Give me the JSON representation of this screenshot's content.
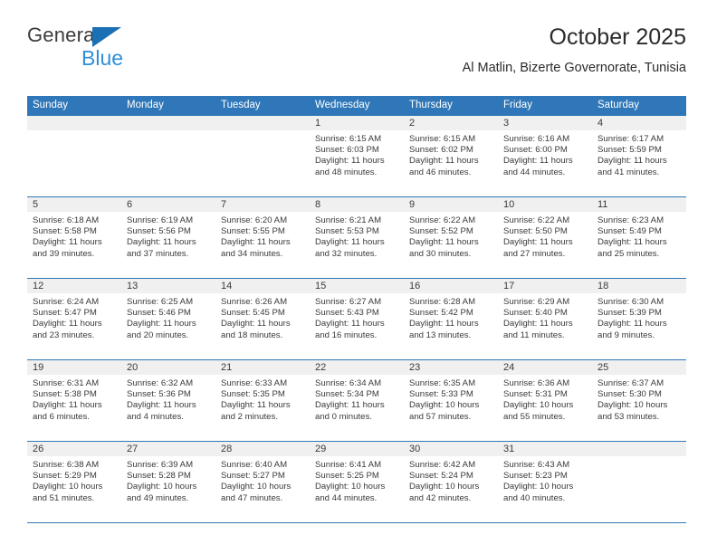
{
  "brand": {
    "name_part1": "General",
    "name_part2": "Blue",
    "triangle_color": "#1a6fb5",
    "blue_color": "#2f8fd8"
  },
  "header": {
    "title": "October 2025",
    "subtitle": "Al Matlin, Bizerte Governorate, Tunisia"
  },
  "theme": {
    "header_blue": "#2f77b8",
    "daynum_band": "#f0f0f0",
    "text": "#3a3a3a"
  },
  "weekdays": [
    "Sunday",
    "Monday",
    "Tuesday",
    "Wednesday",
    "Thursday",
    "Friday",
    "Saturday"
  ],
  "weeks": [
    [
      {
        "empty": true
      },
      {
        "empty": true
      },
      {
        "empty": true
      },
      {
        "day": "1",
        "sunrise": "Sunrise: 6:15 AM",
        "sunset": "Sunset: 6:03 PM",
        "daylight1": "Daylight: 11 hours",
        "daylight2": "and 48 minutes."
      },
      {
        "day": "2",
        "sunrise": "Sunrise: 6:15 AM",
        "sunset": "Sunset: 6:02 PM",
        "daylight1": "Daylight: 11 hours",
        "daylight2": "and 46 minutes."
      },
      {
        "day": "3",
        "sunrise": "Sunrise: 6:16 AM",
        "sunset": "Sunset: 6:00 PM",
        "daylight1": "Daylight: 11 hours",
        "daylight2": "and 44 minutes."
      },
      {
        "day": "4",
        "sunrise": "Sunrise: 6:17 AM",
        "sunset": "Sunset: 5:59 PM",
        "daylight1": "Daylight: 11 hours",
        "daylight2": "and 41 minutes."
      }
    ],
    [
      {
        "day": "5",
        "sunrise": "Sunrise: 6:18 AM",
        "sunset": "Sunset: 5:58 PM",
        "daylight1": "Daylight: 11 hours",
        "daylight2": "and 39 minutes."
      },
      {
        "day": "6",
        "sunrise": "Sunrise: 6:19 AM",
        "sunset": "Sunset: 5:56 PM",
        "daylight1": "Daylight: 11 hours",
        "daylight2": "and 37 minutes."
      },
      {
        "day": "7",
        "sunrise": "Sunrise: 6:20 AM",
        "sunset": "Sunset: 5:55 PM",
        "daylight1": "Daylight: 11 hours",
        "daylight2": "and 34 minutes."
      },
      {
        "day": "8",
        "sunrise": "Sunrise: 6:21 AM",
        "sunset": "Sunset: 5:53 PM",
        "daylight1": "Daylight: 11 hours",
        "daylight2": "and 32 minutes."
      },
      {
        "day": "9",
        "sunrise": "Sunrise: 6:22 AM",
        "sunset": "Sunset: 5:52 PM",
        "daylight1": "Daylight: 11 hours",
        "daylight2": "and 30 minutes."
      },
      {
        "day": "10",
        "sunrise": "Sunrise: 6:22 AM",
        "sunset": "Sunset: 5:50 PM",
        "daylight1": "Daylight: 11 hours",
        "daylight2": "and 27 minutes."
      },
      {
        "day": "11",
        "sunrise": "Sunrise: 6:23 AM",
        "sunset": "Sunset: 5:49 PM",
        "daylight1": "Daylight: 11 hours",
        "daylight2": "and 25 minutes."
      }
    ],
    [
      {
        "day": "12",
        "sunrise": "Sunrise: 6:24 AM",
        "sunset": "Sunset: 5:47 PM",
        "daylight1": "Daylight: 11 hours",
        "daylight2": "and 23 minutes."
      },
      {
        "day": "13",
        "sunrise": "Sunrise: 6:25 AM",
        "sunset": "Sunset: 5:46 PM",
        "daylight1": "Daylight: 11 hours",
        "daylight2": "and 20 minutes."
      },
      {
        "day": "14",
        "sunrise": "Sunrise: 6:26 AM",
        "sunset": "Sunset: 5:45 PM",
        "daylight1": "Daylight: 11 hours",
        "daylight2": "and 18 minutes."
      },
      {
        "day": "15",
        "sunrise": "Sunrise: 6:27 AM",
        "sunset": "Sunset: 5:43 PM",
        "daylight1": "Daylight: 11 hours",
        "daylight2": "and 16 minutes."
      },
      {
        "day": "16",
        "sunrise": "Sunrise: 6:28 AM",
        "sunset": "Sunset: 5:42 PM",
        "daylight1": "Daylight: 11 hours",
        "daylight2": "and 13 minutes."
      },
      {
        "day": "17",
        "sunrise": "Sunrise: 6:29 AM",
        "sunset": "Sunset: 5:40 PM",
        "daylight1": "Daylight: 11 hours",
        "daylight2": "and 11 minutes."
      },
      {
        "day": "18",
        "sunrise": "Sunrise: 6:30 AM",
        "sunset": "Sunset: 5:39 PM",
        "daylight1": "Daylight: 11 hours",
        "daylight2": "and 9 minutes."
      }
    ],
    [
      {
        "day": "19",
        "sunrise": "Sunrise: 6:31 AM",
        "sunset": "Sunset: 5:38 PM",
        "daylight1": "Daylight: 11 hours",
        "daylight2": "and 6 minutes."
      },
      {
        "day": "20",
        "sunrise": "Sunrise: 6:32 AM",
        "sunset": "Sunset: 5:36 PM",
        "daylight1": "Daylight: 11 hours",
        "daylight2": "and 4 minutes."
      },
      {
        "day": "21",
        "sunrise": "Sunrise: 6:33 AM",
        "sunset": "Sunset: 5:35 PM",
        "daylight1": "Daylight: 11 hours",
        "daylight2": "and 2 minutes."
      },
      {
        "day": "22",
        "sunrise": "Sunrise: 6:34 AM",
        "sunset": "Sunset: 5:34 PM",
        "daylight1": "Daylight: 11 hours",
        "daylight2": "and 0 minutes."
      },
      {
        "day": "23",
        "sunrise": "Sunrise: 6:35 AM",
        "sunset": "Sunset: 5:33 PM",
        "daylight1": "Daylight: 10 hours",
        "daylight2": "and 57 minutes."
      },
      {
        "day": "24",
        "sunrise": "Sunrise: 6:36 AM",
        "sunset": "Sunset: 5:31 PM",
        "daylight1": "Daylight: 10 hours",
        "daylight2": "and 55 minutes."
      },
      {
        "day": "25",
        "sunrise": "Sunrise: 6:37 AM",
        "sunset": "Sunset: 5:30 PM",
        "daylight1": "Daylight: 10 hours",
        "daylight2": "and 53 minutes."
      }
    ],
    [
      {
        "day": "26",
        "sunrise": "Sunrise: 6:38 AM",
        "sunset": "Sunset: 5:29 PM",
        "daylight1": "Daylight: 10 hours",
        "daylight2": "and 51 minutes."
      },
      {
        "day": "27",
        "sunrise": "Sunrise: 6:39 AM",
        "sunset": "Sunset: 5:28 PM",
        "daylight1": "Daylight: 10 hours",
        "daylight2": "and 49 minutes."
      },
      {
        "day": "28",
        "sunrise": "Sunrise: 6:40 AM",
        "sunset": "Sunset: 5:27 PM",
        "daylight1": "Daylight: 10 hours",
        "daylight2": "and 47 minutes."
      },
      {
        "day": "29",
        "sunrise": "Sunrise: 6:41 AM",
        "sunset": "Sunset: 5:25 PM",
        "daylight1": "Daylight: 10 hours",
        "daylight2": "and 44 minutes."
      },
      {
        "day": "30",
        "sunrise": "Sunrise: 6:42 AM",
        "sunset": "Sunset: 5:24 PM",
        "daylight1": "Daylight: 10 hours",
        "daylight2": "and 42 minutes."
      },
      {
        "day": "31",
        "sunrise": "Sunrise: 6:43 AM",
        "sunset": "Sunset: 5:23 PM",
        "daylight1": "Daylight: 10 hours",
        "daylight2": "and 40 minutes."
      },
      {
        "empty": true
      }
    ]
  ]
}
